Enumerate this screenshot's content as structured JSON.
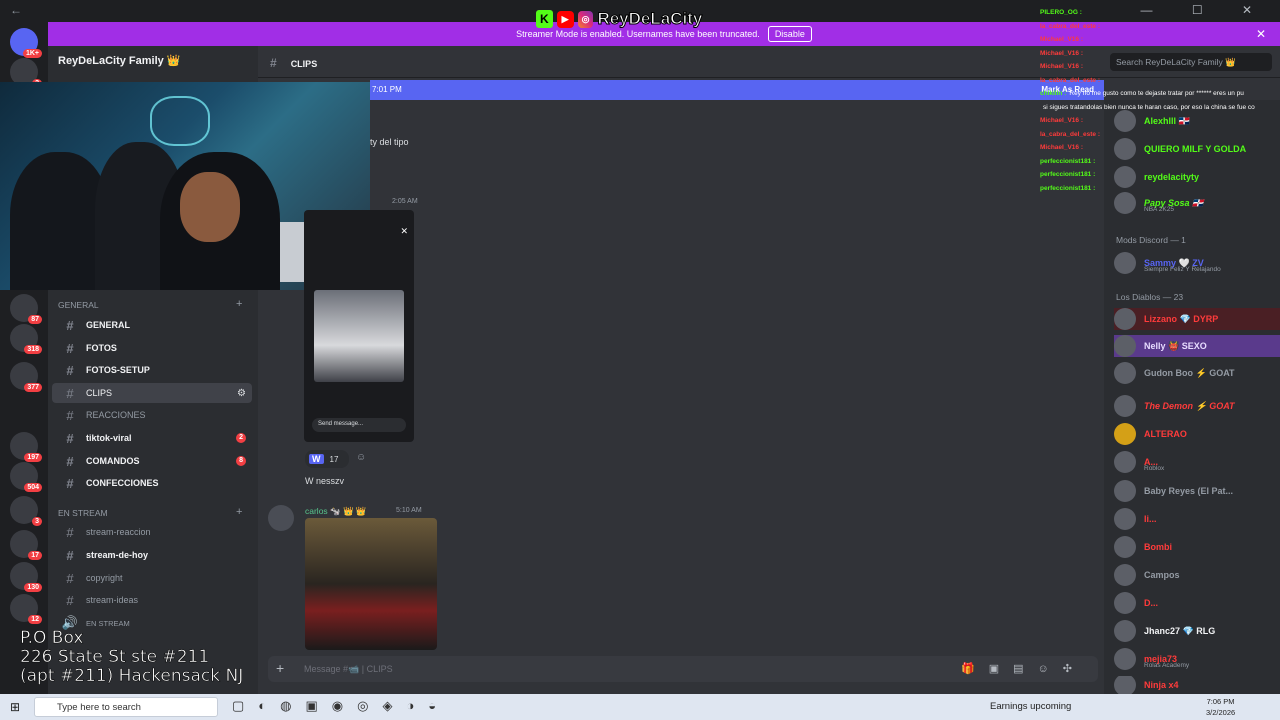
{
  "window": {
    "nav_glyph": "←",
    "controls": "—  ☐  ✕"
  },
  "banner": {
    "text": "Streamer Mode is enabled. Usernames have been truncated.",
    "disable_label": "Disable",
    "close_glyph": "✕",
    "color": "#a12ee6"
  },
  "overlay": {
    "brand": "ReyDeLaCity",
    "address_line1": "P.O Box",
    "address_line2": "226 State St ste #211",
    "address_line3": "(apt #211) Hackensack NJ",
    "live_chat": [
      {
        "user": "PILERO_OG :",
        "text": "",
        "color": "#53fc18"
      },
      {
        "user": "la_cabra_del_este :",
        "text": "",
        "color": "#ff3b3b"
      },
      {
        "user": "Michael_V16 :",
        "text": "",
        "color": "#ff3b3b"
      },
      {
        "user": "Michael_V16 :",
        "text": "",
        "color": "#ff3b3b"
      },
      {
        "user": "Michael_V16 :",
        "text": "",
        "color": "#ff3b3b"
      },
      {
        "user": "la_cabra_del_este :",
        "text": "",
        "color": "#ff3b3b"
      },
      {
        "user": "chikilin :",
        "text": "Rey no me gusto como te dejaste tratar por ****** eres un pu",
        "color": "#53fc18"
      },
      {
        "user": "",
        "text": "si sigues tratandolas bien nunca te haran caso, por eso la china se fue co",
        "color": "#ffffff"
      },
      {
        "user": "Michael_V16 :",
        "text": "",
        "color": "#ff3b3b"
      },
      {
        "user": "la_cabra_del_este :",
        "text": "",
        "color": "#ff3b3b"
      },
      {
        "user": "Michael_V16 :",
        "text": "",
        "color": "#ff3b3b"
      },
      {
        "user": "perfeccionist181 :",
        "text": "",
        "color": "#53fc18"
      },
      {
        "user": "perfeccionist181 :",
        "text": "",
        "color": "#53fc18"
      },
      {
        "user": "perfeccionist181 :",
        "text": "",
        "color": "#53fc18"
      }
    ]
  },
  "server": {
    "name": "ReyDeLaCity Family 👑",
    "badges": [
      "1K+",
      "2",
      "87",
      "318",
      "377",
      "197",
      "504",
      "3",
      "17",
      "130",
      "12"
    ]
  },
  "channels": {
    "category_general": "GENERAL",
    "category_stream": "EN STREAM",
    "general": [
      {
        "name": "GENERAL",
        "badge": ""
      },
      {
        "name": "FOTOS",
        "badge": ""
      },
      {
        "name": "FOTOS-SETUP",
        "badge": ""
      },
      {
        "name": "CLIPS",
        "badge": ""
      },
      {
        "name": "REACCIONES",
        "badge": ""
      },
      {
        "name": "tiktok-viral",
        "badge": "2"
      },
      {
        "name": "COMANDOS",
        "badge": "8"
      },
      {
        "name": "CONFECCIONES",
        "badge": ""
      }
    ],
    "stream": [
      {
        "name": "stream-reaccion"
      },
      {
        "name": "stream-de-hoy"
      },
      {
        "name": "copyright"
      },
      {
        "name": "stream-ideas"
      },
      {
        "name": "EN STREAM"
      }
    ]
  },
  "header": {
    "channel": "CLIPS",
    "search_placeholder": "Search ReyDeLaCity Family 👑"
  },
  "new_messages": {
    "time": "7:01 PM",
    "mark_label": "Mark As Read"
  },
  "messages": {
    "fragment1": "ty del tipo",
    "ts1": "2:05 AM",
    "embed_send": "Send message...",
    "reaction_emoji": "W",
    "reaction_count": "17",
    "text1": "W nesszv",
    "author2": "carlos 🐄 👑 👑",
    "ts2": "5:10 AM"
  },
  "composer": {
    "placeholder": "Message #📹 | CLIPS"
  },
  "members": {
    "top": [
      {
        "name": "Alexhlll 🇩🇴",
        "color": "#53fc18",
        "sub": ""
      },
      {
        "name": "QUIERO MILF Y GOLDA",
        "color": "#53fc18",
        "sub": ""
      },
      {
        "name": "reydelacityty",
        "color": "#53fc18",
        "sub": ""
      },
      {
        "name": "Papy Sosa 🇩🇴",
        "color": "#53fc18",
        "sub": "NBA 2K25"
      }
    ],
    "group_mods": "Mods Discord — 1",
    "mods": [
      {
        "name": "Sammy 🤍 ZV",
        "color": "#5865f2",
        "sub": "Siempre Feliz Y Relajando"
      }
    ],
    "group_diablos": "Los Diablos — 23",
    "diablos": [
      {
        "name": "Lizzano 💎 DYRP",
        "color": "#ff3b3b",
        "sub": ""
      },
      {
        "name": "Nelly 👹 SEXO",
        "color": "#b9a4ff",
        "sub": ""
      },
      {
        "name": "Gudon Boo ⚡ GOAT",
        "color": "#949ba4",
        "sub": ""
      },
      {
        "name": "The Demon ⚡ GOAT",
        "color": "#ff3b3b",
        "sub": ""
      },
      {
        "name": "ALTERAO",
        "color": "#ff3b3b",
        "sub": ""
      },
      {
        "name": "A...",
        "color": "#ff3b3b",
        "sub": "Roblox"
      },
      {
        "name": "Baby Reyes (El Pat...",
        "color": "#949ba4",
        "sub": ""
      },
      {
        "name": "li...",
        "color": "#ff3b3b",
        "sub": ""
      },
      {
        "name": "Bombi",
        "color": "#ff3b3b",
        "sub": ""
      },
      {
        "name": "Campos",
        "color": "#949ba4",
        "sub": ""
      },
      {
        "name": "D...",
        "color": "#ff3b3b",
        "sub": ""
      },
      {
        "name": "Jhanc27 💎 RLG",
        "color": "#f2f3f5",
        "sub": ""
      },
      {
        "name": "mejia73",
        "color": "#ff3b3b",
        "sub": "Rolas Academy"
      },
      {
        "name": "Ninja x4",
        "color": "#ff3b3b",
        "sub": ""
      }
    ]
  },
  "taskbar": {
    "search_placeholder": "Type here to search",
    "weather": "Earnings upcoming",
    "time": "7:06 PM",
    "date": "3/2/2026"
  }
}
